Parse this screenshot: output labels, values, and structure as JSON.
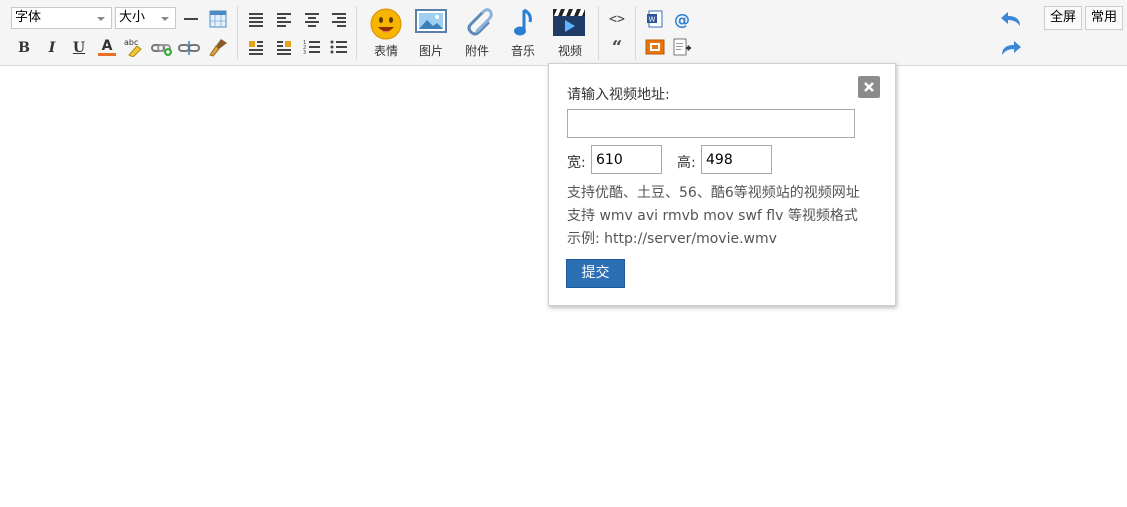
{
  "toolbar": {
    "font_select": {
      "value": "字体"
    },
    "size_select": {
      "value": "大小"
    },
    "media_buttons": [
      {
        "icon": "smiley-icon",
        "label": "表情"
      },
      {
        "icon": "image-icon",
        "label": "图片"
      },
      {
        "icon": "paperclip-icon",
        "label": "附件"
      },
      {
        "icon": "music-note-icon",
        "label": "音乐"
      },
      {
        "icon": "video-clapper-icon",
        "label": "视频"
      }
    ],
    "fullscreen_label": "全屏",
    "common_label": "常用",
    "format_bold": "B",
    "format_italic": "I",
    "format_underline": "U",
    "font_color_letter": "A",
    "highlight_text": "abc",
    "quote_glyph": "“",
    "code_glyph": "<>",
    "at_glyph": "@"
  },
  "video_dialog": {
    "title": "请输入视频地址:",
    "url_value": "",
    "width_label": "宽:",
    "width_value": "610",
    "height_label": "高:",
    "height_value": "498",
    "info_lines": [
      "支持优酷、土豆、56、酷6等视频站的视频网址",
      "支持 wmv avi rmvb mov swf flv 等视频格式",
      "示例: http://server/movie.wmv"
    ],
    "submit_label": "提交"
  },
  "colors": {
    "accent": "#2d6fb5",
    "toolbar_bg": "#f5f5f5"
  }
}
